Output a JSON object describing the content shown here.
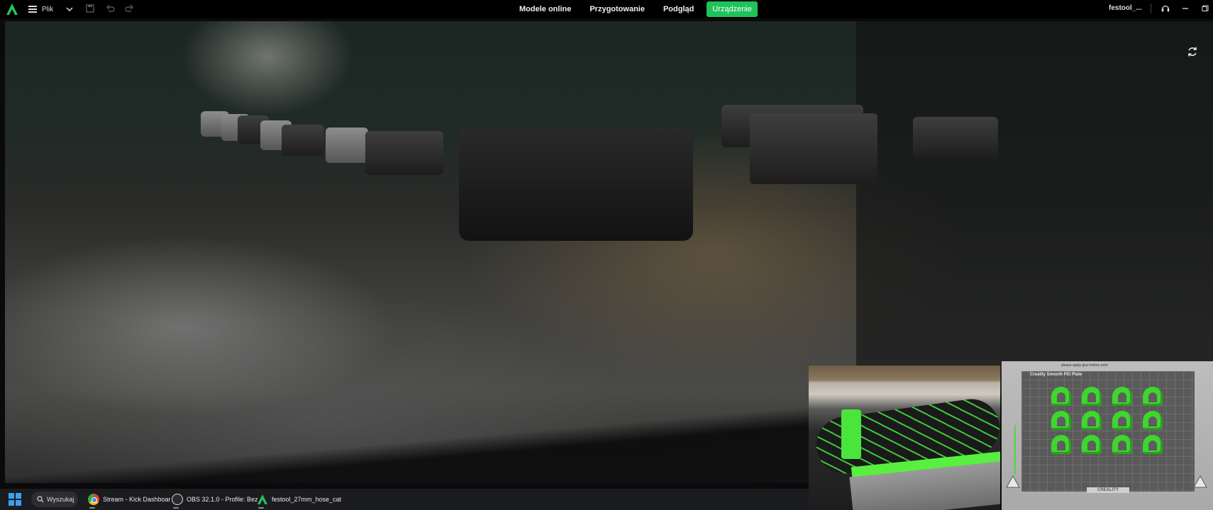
{
  "menu": {
    "file_label": "Plik"
  },
  "nav_tabs": [
    {
      "label": "Modele online"
    },
    {
      "label": "Przygotowanie"
    },
    {
      "label": "Podgląd"
    },
    {
      "label": "Urządzenie",
      "active": true
    }
  ],
  "project_name": "festool_...",
  "pip_slicer": {
    "plate_label": "Creality Smooth PEI Plate",
    "top_hint": "please apply glue before print",
    "brand": "CREALITY"
  },
  "taskbar": {
    "search_label": "Wyszukaj",
    "apps": [
      {
        "label": "Stream - Kick Dashboar"
      },
      {
        "label": "OBS 32.1.0 - Profile: Bez"
      },
      {
        "label": "festool_27mm_hose_cat"
      }
    ]
  },
  "colors": {
    "accent_green": "#1ec35a",
    "topbar_bg": "#000000",
    "taskbar_bg": "#1b1c1f",
    "model_green": "#3fd630"
  },
  "icons": [
    "creality-logo-icon",
    "hamburger-icon",
    "chevron-down-icon",
    "save-icon",
    "undo-icon",
    "redo-icon",
    "support-icon",
    "minimize-icon",
    "maximize-icon",
    "close-icon",
    "refresh-icon",
    "windows-start-icon",
    "search-icon",
    "chrome-icon",
    "obs-icon",
    "creality-print-icon"
  ]
}
